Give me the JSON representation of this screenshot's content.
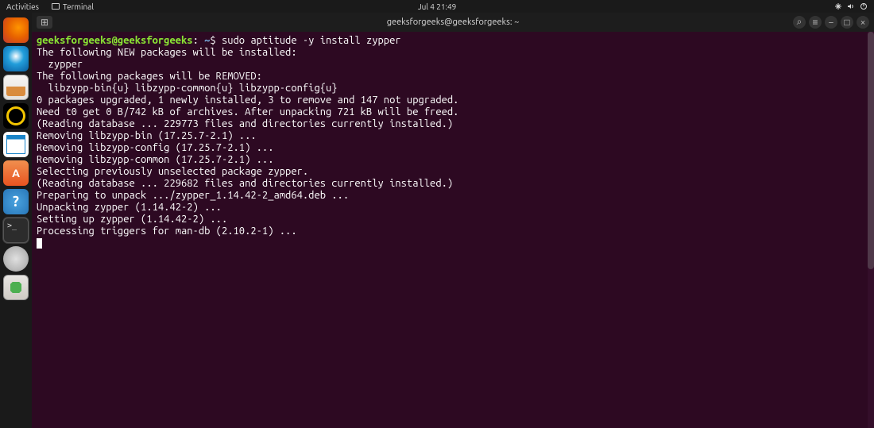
{
  "topbar": {
    "activities": "Activities",
    "terminal_label": "Terminal",
    "datetime": "Jul 4  21:49"
  },
  "window": {
    "title": "geeksforgeeks@geeksforgeeks: ~",
    "new_tab_glyph": "⊞",
    "search_glyph": "⌕",
    "menu_glyph": "≡",
    "min_glyph": "−",
    "max_glyph": "□",
    "close_glyph": "×"
  },
  "prompt": {
    "user_host": "geeksforgeeks@geeksforgeeks",
    "separator": ":",
    "path": " ~",
    "symbol": "$ ",
    "command": "sudo aptitude -y install zypper"
  },
  "output": [
    "The following NEW packages will be installed:",
    "  zypper",
    "The following packages will be REMOVED:",
    "  libzypp-bin{u} libzypp-common{u} libzypp-config{u}",
    "0 packages upgraded, 1 newly installed, 3 to remove and 147 not upgraded.",
    "Need t0 get 0 B/742 kB of archives. After unpacking 721 kB will be freed.",
    "(Reading database ... 229773 files and directories currently installed.)",
    "Removing libzypp-bin (17.25.7-2.1) ...",
    "Removing libzypp-config (17.25.7-2.1) ...",
    "Removing libzypp-common (17.25.7-2.1) ...",
    "Selecting previously unselected package zypper.",
    "(Reading database ... 229682 files and directories currently installed.)",
    "Preparing to unpack .../zypper_1.14.42-2_amd64.deb ...",
    "Unpacking zypper (1.14.42-2) ...",
    "Setting up zypper (1.14.42-2) ...",
    "Processing triggers for man-db (2.10.2-1) ..."
  ]
}
